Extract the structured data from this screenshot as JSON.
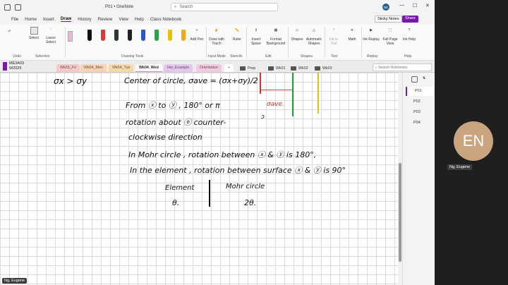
{
  "titlebar": {
    "file_title": "P01 • OneNote",
    "search_placeholder": "Search",
    "user_initials": "NE"
  },
  "menu": {
    "items": [
      "File",
      "Home",
      "Insert",
      "Draw",
      "History",
      "Review",
      "View",
      "Help",
      "Class Notebook"
    ],
    "sticky_notes": "Sticky Notes",
    "share": "Share"
  },
  "ribbon": {
    "select": "Select",
    "lasso": "Lasso Select",
    "add_pen": "Add Pen",
    "draw_touch": "Draw with Touch",
    "ruler": "Ruler",
    "insert_space": "Insert Space",
    "format_bg": "Format Background",
    "shapes": "Shapes",
    "auto_shapes": "Automatic Shapes",
    "ink_text": "Ink to Text",
    "math": "Math",
    "ink_replay": "Ink Replay",
    "full_view": "Full Page View",
    "ink_help": "Ink Help",
    "groups": [
      "Undo",
      "Selection",
      "Drawing Tools",
      "Input Mode",
      "Stencils",
      "Edit",
      "Shapes",
      "Text",
      "Replay",
      "Help"
    ],
    "pen_colors": [
      "#111111",
      "#d63a3a",
      "#333333",
      "#222222",
      "#2b58c7",
      "#23a34a",
      "#e8c200",
      "#f0a818"
    ]
  },
  "notebook": {
    "name": "ME3A03",
    "term": "W2025",
    "search_placeholder": "Search Notebooks"
  },
  "sections": [
    "Wk03_Fri",
    "Wk04_Mon",
    "Wk04_Tue",
    "Wk04_Wed",
    "Hw_Example",
    "Orientation",
    "+"
  ],
  "groups": [
    "Prep",
    "Wk01",
    "Wk02",
    "Wk03"
  ],
  "pages": [
    "P01",
    "P02",
    "P03",
    "P04"
  ],
  "notes": {
    "line0": "σx > σy",
    "line0b": "Center of circle, σave = (σx+σy)/2",
    "sigma_ave": "σave.",
    "line1": "From ⓧ to ⓨ , 180° or π",
    "line2": "rotation about ⓞ counter-",
    "line3": "clockwise direction",
    "line4": "In Mohr circle , rotation between ⓧ & ⓨ is 180°,",
    "line5": "In the element , rotation between surface ⓧ & ⓨ is 90°",
    "element": "Element",
    "mohr": "Mohr circle",
    "theta": "θ.",
    "two_theta": "2θ."
  },
  "participant": {
    "initials": "EN",
    "name": "Ng, Eugene"
  }
}
